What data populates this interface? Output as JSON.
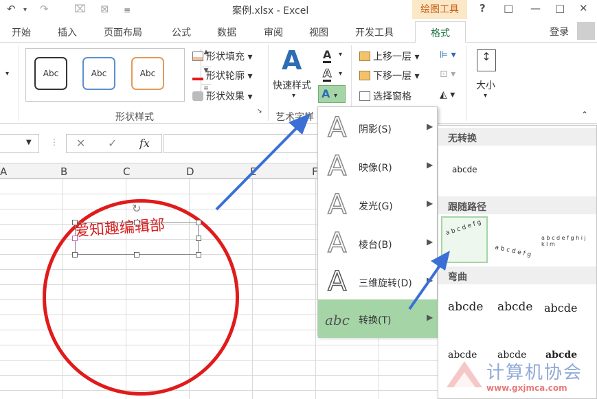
{
  "window": {
    "title": "案例.xlsx - Excel",
    "context_tab": "绘图工具",
    "help": "?",
    "restore": "□",
    "minimize": "—",
    "maximize": "□",
    "close": "✕"
  },
  "qat": {
    "undo": "↶",
    "redo": "↷"
  },
  "tabs": [
    "开始",
    "插入",
    "页面布局",
    "公式",
    "数据",
    "审阅",
    "视图",
    "开发工具",
    "格式"
  ],
  "signin": "登录",
  "ribbon": {
    "shape_styles": {
      "samples": [
        "Abc",
        "Abc",
        "Abc"
      ],
      "fill": "形状填充",
      "outline": "形状轮廓",
      "effects": "形状效果",
      "group": "形状样式"
    },
    "wordart": {
      "quick": "快速样式",
      "group": "艺术字样"
    },
    "arrange": {
      "forward": "上移一层",
      "backward": "下移一层",
      "selection": "选择窗格"
    },
    "size": "大小"
  },
  "formula": {
    "fx": "fx"
  },
  "columns": [
    "A",
    "B",
    "C",
    "D",
    "E",
    "F"
  ],
  "shape_text": "爱知趣编辑部",
  "effects_menu": [
    {
      "label": "阴影(S)"
    },
    {
      "label": "映像(R)"
    },
    {
      "label": "发光(G)"
    },
    {
      "label": "棱台(B)"
    },
    {
      "label": "三维旋转(D)"
    },
    {
      "label": "转换(T)",
      "icon": "abc"
    }
  ],
  "transform_menu": {
    "no_transform": "无转换",
    "sample": "abcde",
    "follow_path": "跟随路径",
    "path_circle": "a b c d e f g",
    "path_arch": "a b c d e f g",
    "path_round": "a b c d e f g h i j k l m",
    "warp": "弯曲",
    "warp_samples": [
      "abcde",
      "abcde",
      "abcde",
      "abcde",
      "abcde",
      "abcde"
    ]
  },
  "watermark": {
    "text": "计算机协会",
    "url": "www.gxjmca.com"
  },
  "colors": {
    "accent": "#217346",
    "highlight": "#a5d5a7",
    "circle": "#e01b1b",
    "arrow": "#3b6fd6"
  }
}
